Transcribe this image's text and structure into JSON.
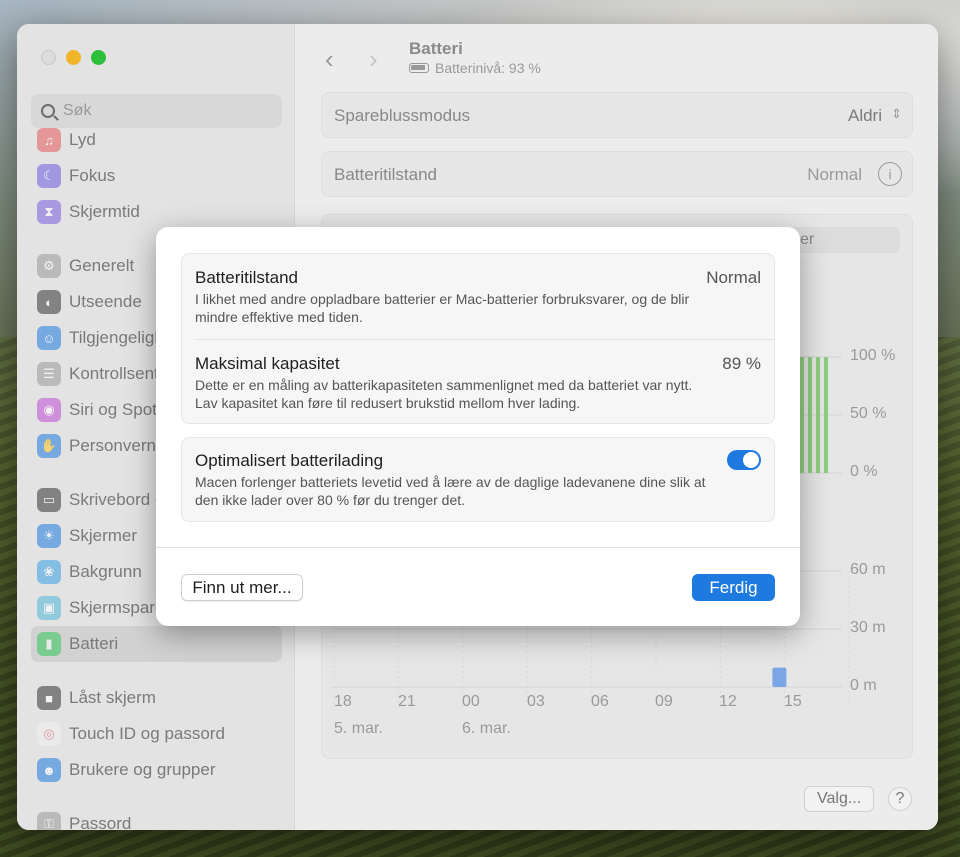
{
  "colors": {
    "accent": "#1f7ae0",
    "battery_green": "#8ccf7e",
    "usage_blue": "#7aa6e6"
  },
  "window": {
    "search_placeholder": "Søk",
    "sidebar": [
      {
        "label": "Lyd",
        "icon": "speaker-icon",
        "color": "#e85a5a"
      },
      {
        "label": "Fokus",
        "icon": "moon-icon",
        "color": "#6d5be0"
      },
      {
        "label": "Skjermtid",
        "icon": "hourglass-icon",
        "color": "#7a5de0"
      },
      {
        "label": "Generelt",
        "icon": "gear-icon",
        "color": "#9a9a9a"
      },
      {
        "label": "Utseende",
        "icon": "appearance-icon",
        "color": "#333333"
      },
      {
        "label": "Tilgjengelighet",
        "icon": "accessibility-icon",
        "color": "#1f7ae0"
      },
      {
        "label": "Kontrollsenter",
        "icon": "control-center-icon",
        "color": "#9a9a9a"
      },
      {
        "label": "Siri og Spotlight",
        "icon": "siri-icon",
        "color": "#c04dd6"
      },
      {
        "label": "Personvern og sikkerhet",
        "icon": "hand-icon",
        "color": "#1f7ae0"
      },
      {
        "label": "Skrivebord og Dock",
        "icon": "desktop-icon",
        "color": "#333333"
      },
      {
        "label": "Skjermer",
        "icon": "sun-icon",
        "color": "#1f7ae0"
      },
      {
        "label": "Bakgrunn",
        "icon": "flower-icon",
        "color": "#3aa0e6"
      },
      {
        "label": "Skjermsparer",
        "icon": "screensaver-icon",
        "color": "#4fb6d9"
      },
      {
        "label": "Batteri",
        "icon": "battery-icon",
        "color": "#34c759"
      },
      {
        "label": "Låst skjerm",
        "icon": "lock-icon",
        "color": "#333333"
      },
      {
        "label": "Touch ID og passord",
        "icon": "fingerprint-icon",
        "color": "#f0f0f0"
      },
      {
        "label": "Brukere og grupper",
        "icon": "users-icon",
        "color": "#1f7ae0"
      },
      {
        "label": "Passord",
        "icon": "key-icon",
        "color": "#9a9a9a"
      }
    ],
    "title": "Batteri",
    "subtitle": "Batterinivå: 93 %",
    "power_mode_label": "Spareblussmodus",
    "power_mode_value": "Aldri",
    "health_label": "Batteritilstand",
    "health_value": "Normal",
    "partial_tab": "er",
    "level_ticks": [
      "100 %",
      "50 %",
      "0 %"
    ],
    "partial_x_label": "5",
    "usage_ticks": [
      "60 m",
      "30 m",
      "0 m"
    ],
    "x_ticks": [
      "18",
      "21",
      "00",
      "03",
      "06",
      "09",
      "12",
      "15"
    ],
    "dates": [
      "5. mar.",
      "6. mar."
    ],
    "options_button": "Valg...",
    "help_button": "?"
  },
  "chart_data": [
    {
      "type": "bar",
      "title": "",
      "ylabel": "",
      "ylim": [
        0,
        100
      ],
      "y_ticks": [
        "100 %",
        "50 %",
        "0 %"
      ],
      "series": [
        {
          "values": [
            100,
            100,
            100,
            100
          ]
        }
      ]
    },
    {
      "type": "bar",
      "title": "",
      "ylabel": "",
      "ylim": [
        0,
        60
      ],
      "y_ticks": [
        "60 m",
        "30 m",
        "0 m"
      ],
      "categories": [
        "18",
        "21",
        "00",
        "03",
        "06",
        "09",
        "12",
        "15"
      ],
      "series": [
        {
          "values": [
            0,
            0,
            0,
            0,
            0,
            0,
            10,
            0
          ]
        }
      ]
    }
  ],
  "dialog": {
    "health_title": "Batteritilstand",
    "health_value": "Normal",
    "health_desc": "I likhet med andre oppladbare batterier er Mac-batterier forbruksvarer, og de blir mindre effektive med tiden.",
    "capacity_title": "Maksimal kapasitet",
    "capacity_value": "89 %",
    "capacity_desc": "Dette er en måling av batterikapasiteten sammenlignet med da batteriet var nytt. Lav kapasitet kan føre til redusert brukstid mellom hver lading.",
    "optimized_title": "Optimalisert batterilading",
    "optimized_desc": "Macen forlenger batteriets levetid ved å lære av de daglige ladevanene dine slik at den ikke lader over 80 % før du trenger det.",
    "optimized_on": true,
    "learn_more_button": "Finn ut mer...",
    "done_button": "Ferdig"
  }
}
